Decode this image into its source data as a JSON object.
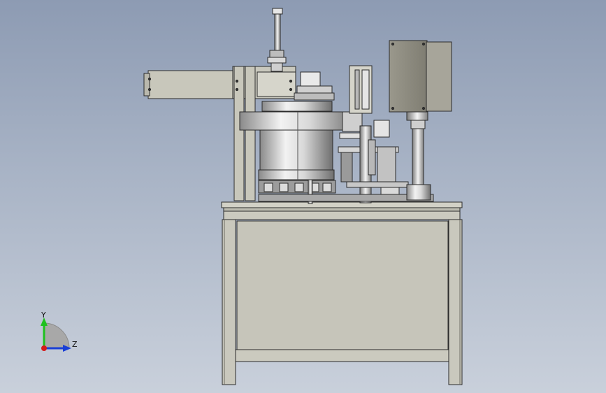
{
  "viewport": {
    "background_top": "#8d9bb3",
    "background_bottom": "#c9d0db"
  },
  "triad": {
    "y_label": "Y",
    "z_label": "Z",
    "y_color": "#1ec11e",
    "z_color": "#1a3fd6",
    "x_color": "#d41a1a"
  },
  "model": {
    "frame_color": "#c8c7bb",
    "frame_edge": "#2b2b2b",
    "steel_color": "#cfcfcf",
    "controller_color": "#8e8c80"
  }
}
